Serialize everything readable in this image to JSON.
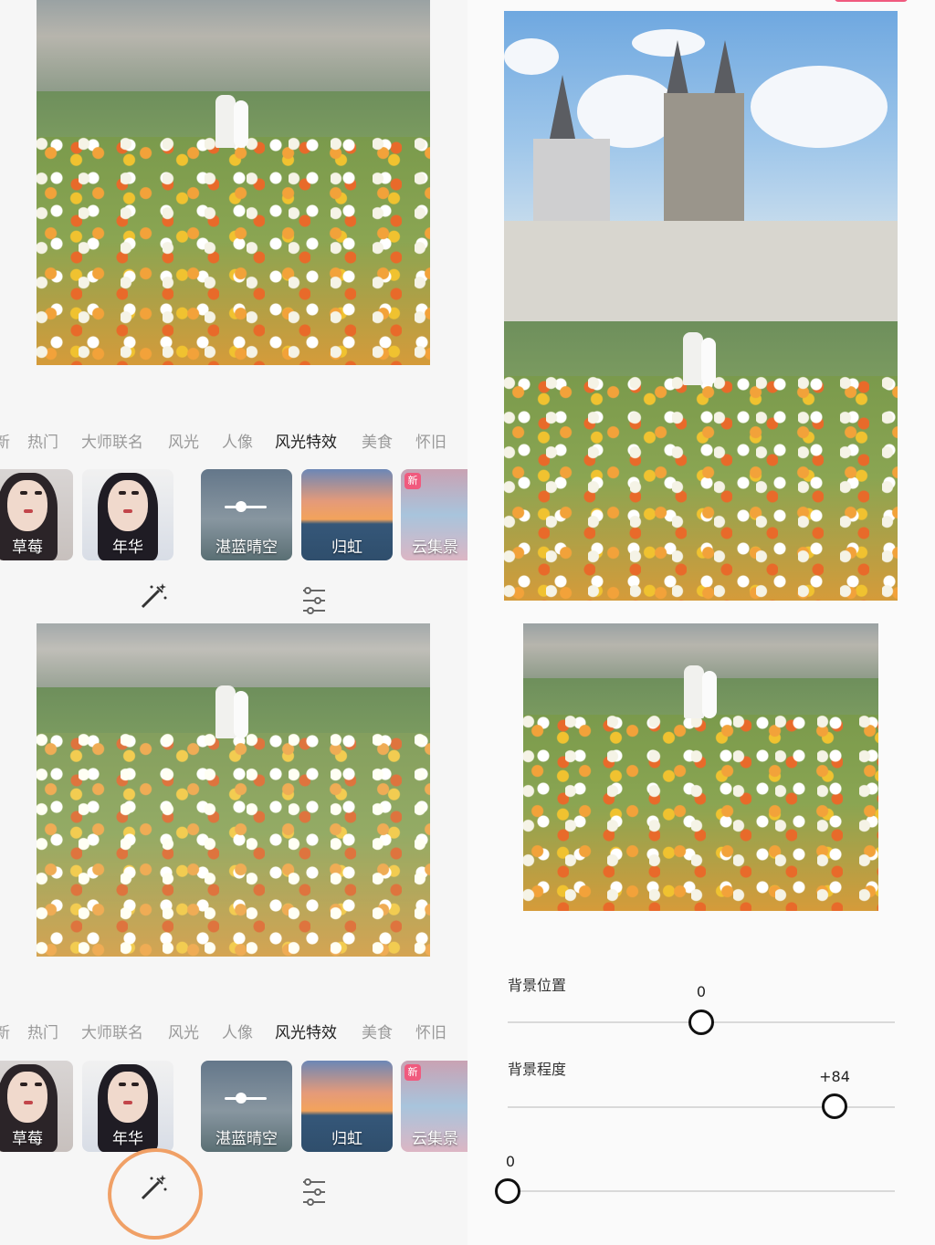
{
  "categories": [
    "新",
    "热门",
    "大师联名",
    "风光",
    "人像",
    "风光特效",
    "美食",
    "怀旧"
  ],
  "filters": [
    {
      "label": "草莓",
      "badge": ""
    },
    {
      "label": "年华",
      "badge": ""
    },
    {
      "label": "湛蓝晴空",
      "badge": ""
    },
    {
      "label": "归虹",
      "badge": ""
    },
    {
      "label": "云集景",
      "badge": "新"
    }
  ],
  "tools": {
    "magic": "magic-wand-icon",
    "adjust": "sliders-icon"
  },
  "sliders": [
    {
      "label": "背景位置",
      "value": "0"
    },
    {
      "label": "背景程度",
      "value": "+84"
    },
    {
      "label": "",
      "value": "0"
    }
  ],
  "colors": {
    "accent_circle": "#f0a066",
    "new_badge": "#f05a7e"
  }
}
